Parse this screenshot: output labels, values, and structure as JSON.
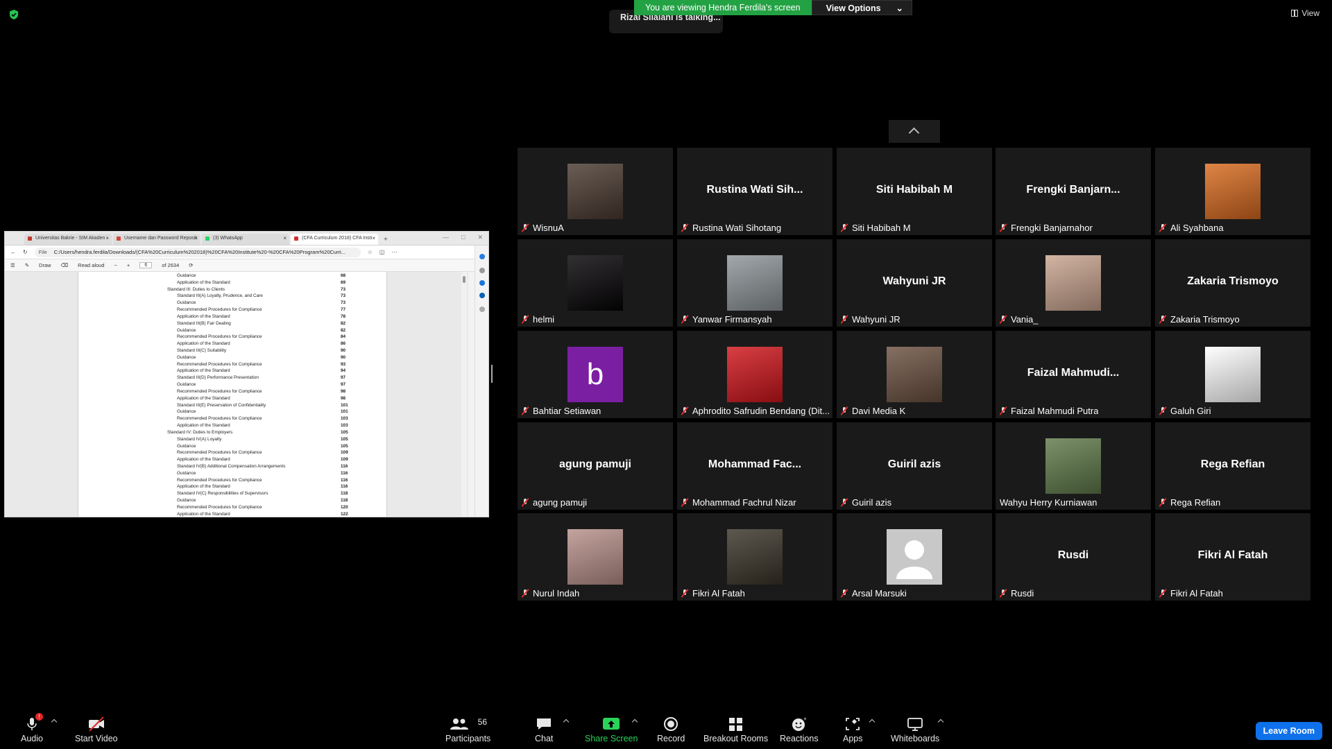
{
  "banner": {
    "viewing": "You are viewing Hendra Ferdila's screen",
    "view_options": "View Options",
    "talking": "Rizal Silalahi is talking...",
    "view_button": "View"
  },
  "browser": {
    "tabs": [
      {
        "title": "Universitas Bakrie - SIM Akaden",
        "color": "#c0392b"
      },
      {
        "title": "Username dan Password Reposit",
        "color": "#d44638"
      },
      {
        "title": "(3) WhatsApp",
        "color": "#25d366"
      },
      {
        "title": "(CFA Curriculum 2018) CFA Insti",
        "color": "#d32f2f"
      }
    ],
    "address_prefix": "File",
    "address": "C:/Users/hendra.ferdila/Downloads/(CFA%20Curriculum%202018)%20CFA%20Institute%20-%20CFA%20Program%20Curri...",
    "pdf": {
      "draw": "Draw",
      "read_aloud": "Read aloud",
      "page": "6",
      "of_pages": "of 2634"
    },
    "toc": [
      {
        "indent": 2,
        "text": "Guidance",
        "page": "68"
      },
      {
        "indent": 2,
        "text": "Application of the Standard",
        "page": "69"
      },
      {
        "indent": 1,
        "text": "Standard III: Duties to Clients",
        "page": "73"
      },
      {
        "indent": 2,
        "text": "Standard III(A) Loyalty, Prudence, and Care",
        "page": "73"
      },
      {
        "indent": 2,
        "text": "Guidance",
        "page": "73"
      },
      {
        "indent": 2,
        "text": "Recommended Procedures for Compliance",
        "page": "77"
      },
      {
        "indent": 2,
        "text": "Application of the Standard",
        "page": "78"
      },
      {
        "indent": 2,
        "text": "Standard III(B) Fair Dealing",
        "page": "82"
      },
      {
        "indent": 2,
        "text": "Guidance",
        "page": "82"
      },
      {
        "indent": 2,
        "text": "Recommended Procedures for Compliance",
        "page": "84"
      },
      {
        "indent": 2,
        "text": "Application of the Standard",
        "page": "86"
      },
      {
        "indent": 2,
        "text": "Standard III(C) Suitability",
        "page": "90"
      },
      {
        "indent": 2,
        "text": "Guidance",
        "page": "90"
      },
      {
        "indent": 2,
        "text": "Recommended Procedures for Compliance",
        "page": "93"
      },
      {
        "indent": 2,
        "text": "Application of the Standard",
        "page": "94"
      },
      {
        "indent": 2,
        "text": "Standard III(D) Performance Presentation",
        "page": "97"
      },
      {
        "indent": 2,
        "text": "Guidance",
        "page": "97"
      },
      {
        "indent": 2,
        "text": "Recommended Procedures for Compliance",
        "page": "98"
      },
      {
        "indent": 2,
        "text": "Application of the Standard",
        "page": "98"
      },
      {
        "indent": 2,
        "text": "Standard III(E) Preservation of Confidentiality",
        "page": "101"
      },
      {
        "indent": 2,
        "text": "Guidance",
        "page": "101"
      },
      {
        "indent": 2,
        "text": "Recommended Procedures for Compliance",
        "page": "103"
      },
      {
        "indent": 2,
        "text": "Application of the Standard",
        "page": "103"
      },
      {
        "indent": 1,
        "text": "Standard IV: Duties to Employers",
        "page": "105"
      },
      {
        "indent": 2,
        "text": "Standard IV(A) Loyalty",
        "page": "105"
      },
      {
        "indent": 2,
        "text": "Guidance",
        "page": "105"
      },
      {
        "indent": 2,
        "text": "Recommended Procedures for Compliance",
        "page": "109"
      },
      {
        "indent": 2,
        "text": "Application of the Standard",
        "page": "109"
      },
      {
        "indent": 2,
        "text": "Standard IV(B) Additional Compensation Arrangements",
        "page": "116"
      },
      {
        "indent": 2,
        "text": "Guidance",
        "page": "116"
      },
      {
        "indent": 2,
        "text": "Recommended Procedures for Compliance",
        "page": "116"
      },
      {
        "indent": 2,
        "text": "Application of the Standard",
        "page": "116"
      },
      {
        "indent": 2,
        "text": "Standard IV(C) Responsibilities of Supervisors",
        "page": "118"
      },
      {
        "indent": 2,
        "text": "Guidance",
        "page": "118"
      },
      {
        "indent": 2,
        "text": "Recommended Procedures for Compliance",
        "page": "120"
      },
      {
        "indent": 2,
        "text": "Application of the Standard",
        "page": "122"
      }
    ]
  },
  "participants": [
    {
      "name": "WisnuA",
      "big": "",
      "avatar": "photo",
      "color": "#4a3a30"
    },
    {
      "name": "Rustina Wati Sihotang",
      "big": "Rustina  Wati  Sih...",
      "avatar": "none",
      "color": ""
    },
    {
      "name": "Siti Habibah M",
      "big": "Siti Habibah M",
      "avatar": "none",
      "color": ""
    },
    {
      "name": "Frengki Banjarnahor",
      "big": "Frengki  Banjarn...",
      "avatar": "none",
      "color": ""
    },
    {
      "name": "Ali Syahbana",
      "big": "",
      "avatar": "photo",
      "color": "#d86a1e"
    },
    {
      "name": "helmi",
      "big": "",
      "avatar": "photo",
      "color": "#050305"
    },
    {
      "name": "Yanwar Firmansyah",
      "big": "",
      "avatar": "photo",
      "color": "#8e9599"
    },
    {
      "name": "Wahyuni JR",
      "big": "Wahyuni JR",
      "avatar": "none",
      "color": ""
    },
    {
      "name": "Vania_",
      "big": "",
      "avatar": "photo",
      "color": "#c9a48f"
    },
    {
      "name": "Zakaria Trismoyo",
      "big": "Zakaria Trismoyo",
      "avatar": "none",
      "color": ""
    },
    {
      "name": "Bahtiar Setiawan",
      "big": "",
      "avatar": "letter",
      "letter": "b",
      "color": "#7b1fa2"
    },
    {
      "name": "Aphrodito Safrudin Bendang (Dit...",
      "big": "",
      "avatar": "photo",
      "color": "#d0151b"
    },
    {
      "name": "Davi Media K",
      "big": "",
      "avatar": "photo",
      "color": "#6b5040"
    },
    {
      "name": "Faizal Mahmudi Putra",
      "big": "Faizal  Mahmudi...",
      "avatar": "none",
      "color": ""
    },
    {
      "name": "Galuh Giri",
      "big": "",
      "avatar": "photo",
      "color": "#ffffff"
    },
    {
      "name": "agung pamuji",
      "big": "agung pamuji",
      "avatar": "none",
      "color": ""
    },
    {
      "name": "Mohammad Fachrul Nizar",
      "big": "Mohammad  Fac...",
      "avatar": "none",
      "color": ""
    },
    {
      "name": "Guiril azis",
      "big": "Guiril azis",
      "avatar": "none",
      "color": ""
    },
    {
      "name": "Wahyu Herry Kurniawan",
      "big": "",
      "avatar": "photo",
      "color": "#5f7a4a",
      "nomic": true
    },
    {
      "name": "Rega Refian",
      "big": "Rega Refian",
      "avatar": "none",
      "color": ""
    },
    {
      "name": "Nurul Indah",
      "big": "",
      "avatar": "photo",
      "color": "#b8908a"
    },
    {
      "name": "Fikri Al Fatah",
      "big": "",
      "avatar": "photo",
      "color": "#3a3428"
    },
    {
      "name": "Arsal Marsuki",
      "big": "",
      "avatar": "default",
      "color": "#c8c8c8"
    },
    {
      "name": "Rusdi",
      "big": "Rusdi",
      "avatar": "none",
      "color": ""
    },
    {
      "name": "Fikri Al Fatah",
      "big": "Fikri Al Fatah",
      "avatar": "none",
      "color": ""
    }
  ],
  "toolbar": {
    "audio": "Audio",
    "audio_badge": "!",
    "start_video": "Start Video",
    "participants": "Participants",
    "participants_count": "56",
    "chat": "Chat",
    "share_screen": "Share Screen",
    "record": "Record",
    "breakout_rooms": "Breakout Rooms",
    "reactions": "Reactions",
    "apps": "Apps",
    "whiteboards": "Whiteboards",
    "leave_room": "Leave Room"
  },
  "colors": {
    "accent_green": "#23a244",
    "leave_blue": "#0e71eb",
    "muted_red": "#e02828"
  }
}
